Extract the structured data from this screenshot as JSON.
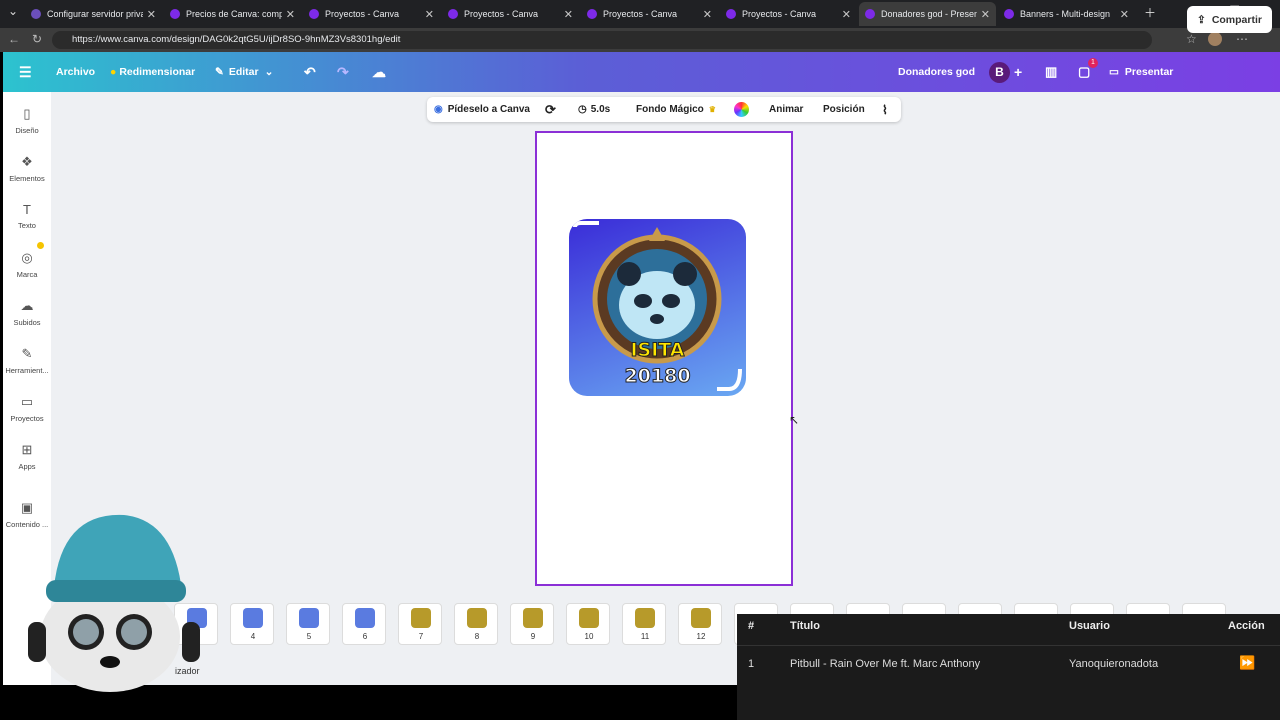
{
  "browser": {
    "tabs": [
      {
        "title": "Configurar servidor privado",
        "color": "#6b4fbb",
        "active": false
      },
      {
        "title": "Precios de Canva: compara l",
        "color": "#7d2ae8",
        "active": false
      },
      {
        "title": "Proyectos - Canva",
        "color": "#7d2ae8",
        "active": false
      },
      {
        "title": "Proyectos - Canva",
        "color": "#7d2ae8",
        "active": false
      },
      {
        "title": "Proyectos - Canva",
        "color": "#7d2ae8",
        "active": false
      },
      {
        "title": "Proyectos - Canva",
        "color": "#7d2ae8",
        "active": false
      },
      {
        "title": "Donadores god - Presentaci",
        "color": "#7d2ae8",
        "active": true
      },
      {
        "title": "Banners - Multi-design",
        "color": "#7d2ae8",
        "active": false
      }
    ],
    "url": "https://www.canva.com/design/DAG0k2qtG5U/ijDr8SO-9hnMZ3Vs8301hg/edit"
  },
  "header": {
    "archivo": "Archivo",
    "redimensionar": "Redimensionar",
    "editar": "Editar",
    "design_title": "Donadores god",
    "avatar_letter": "B",
    "comments_badge": "1",
    "presentar": "Presentar",
    "compartir": "Compartir"
  },
  "sidebar": {
    "items": [
      {
        "label": "Diseño",
        "icon": "layout-icon"
      },
      {
        "label": "Elementos",
        "icon": "shapes-icon"
      },
      {
        "label": "Texto",
        "icon": "text-icon"
      },
      {
        "label": "Marca",
        "icon": "brand-icon"
      },
      {
        "label": "Subidos",
        "icon": "cloud-upload-icon"
      },
      {
        "label": "Herramient...",
        "icon": "draw-icon"
      },
      {
        "label": "Proyectos",
        "icon": "folder-icon"
      },
      {
        "label": "Apps",
        "icon": "apps-icon"
      },
      {
        "label": "Contenido ...",
        "icon": "magic-media-icon"
      }
    ]
  },
  "toolbar": {
    "ask_canva": "Pídeselo a Canva",
    "duration": "5.0s",
    "fondo_magico": "Fondo Mágico",
    "animar": "Animar",
    "posicion": "Posición"
  },
  "canvas": {
    "badge_line1": "ISITA",
    "badge_line2": "20180"
  },
  "thumbnails": [
    {
      "num": "3",
      "color": "#5a7be0"
    },
    {
      "num": "4",
      "color": "#5a7be0"
    },
    {
      "num": "5",
      "color": "#5a7be0"
    },
    {
      "num": "6",
      "color": "#5a7be0"
    },
    {
      "num": "7",
      "color": "#b79a2a"
    },
    {
      "num": "8",
      "color": "#b79a2a"
    },
    {
      "num": "9",
      "color": "#b79a2a"
    },
    {
      "num": "10",
      "color": "#b79a2a"
    },
    {
      "num": "11",
      "color": "#b79a2a"
    },
    {
      "num": "12",
      "color": "#b79a2a"
    }
  ],
  "thumb_partial_label": "izador",
  "queue": {
    "headers": {
      "num": "#",
      "title": "Título",
      "user": "Usuario",
      "action": "Acción"
    },
    "rows": [
      {
        "num": "1",
        "title": "Pitbull - Rain Over Me ft. Marc Anthony",
        "user": "Yanoquieronadota"
      }
    ]
  }
}
